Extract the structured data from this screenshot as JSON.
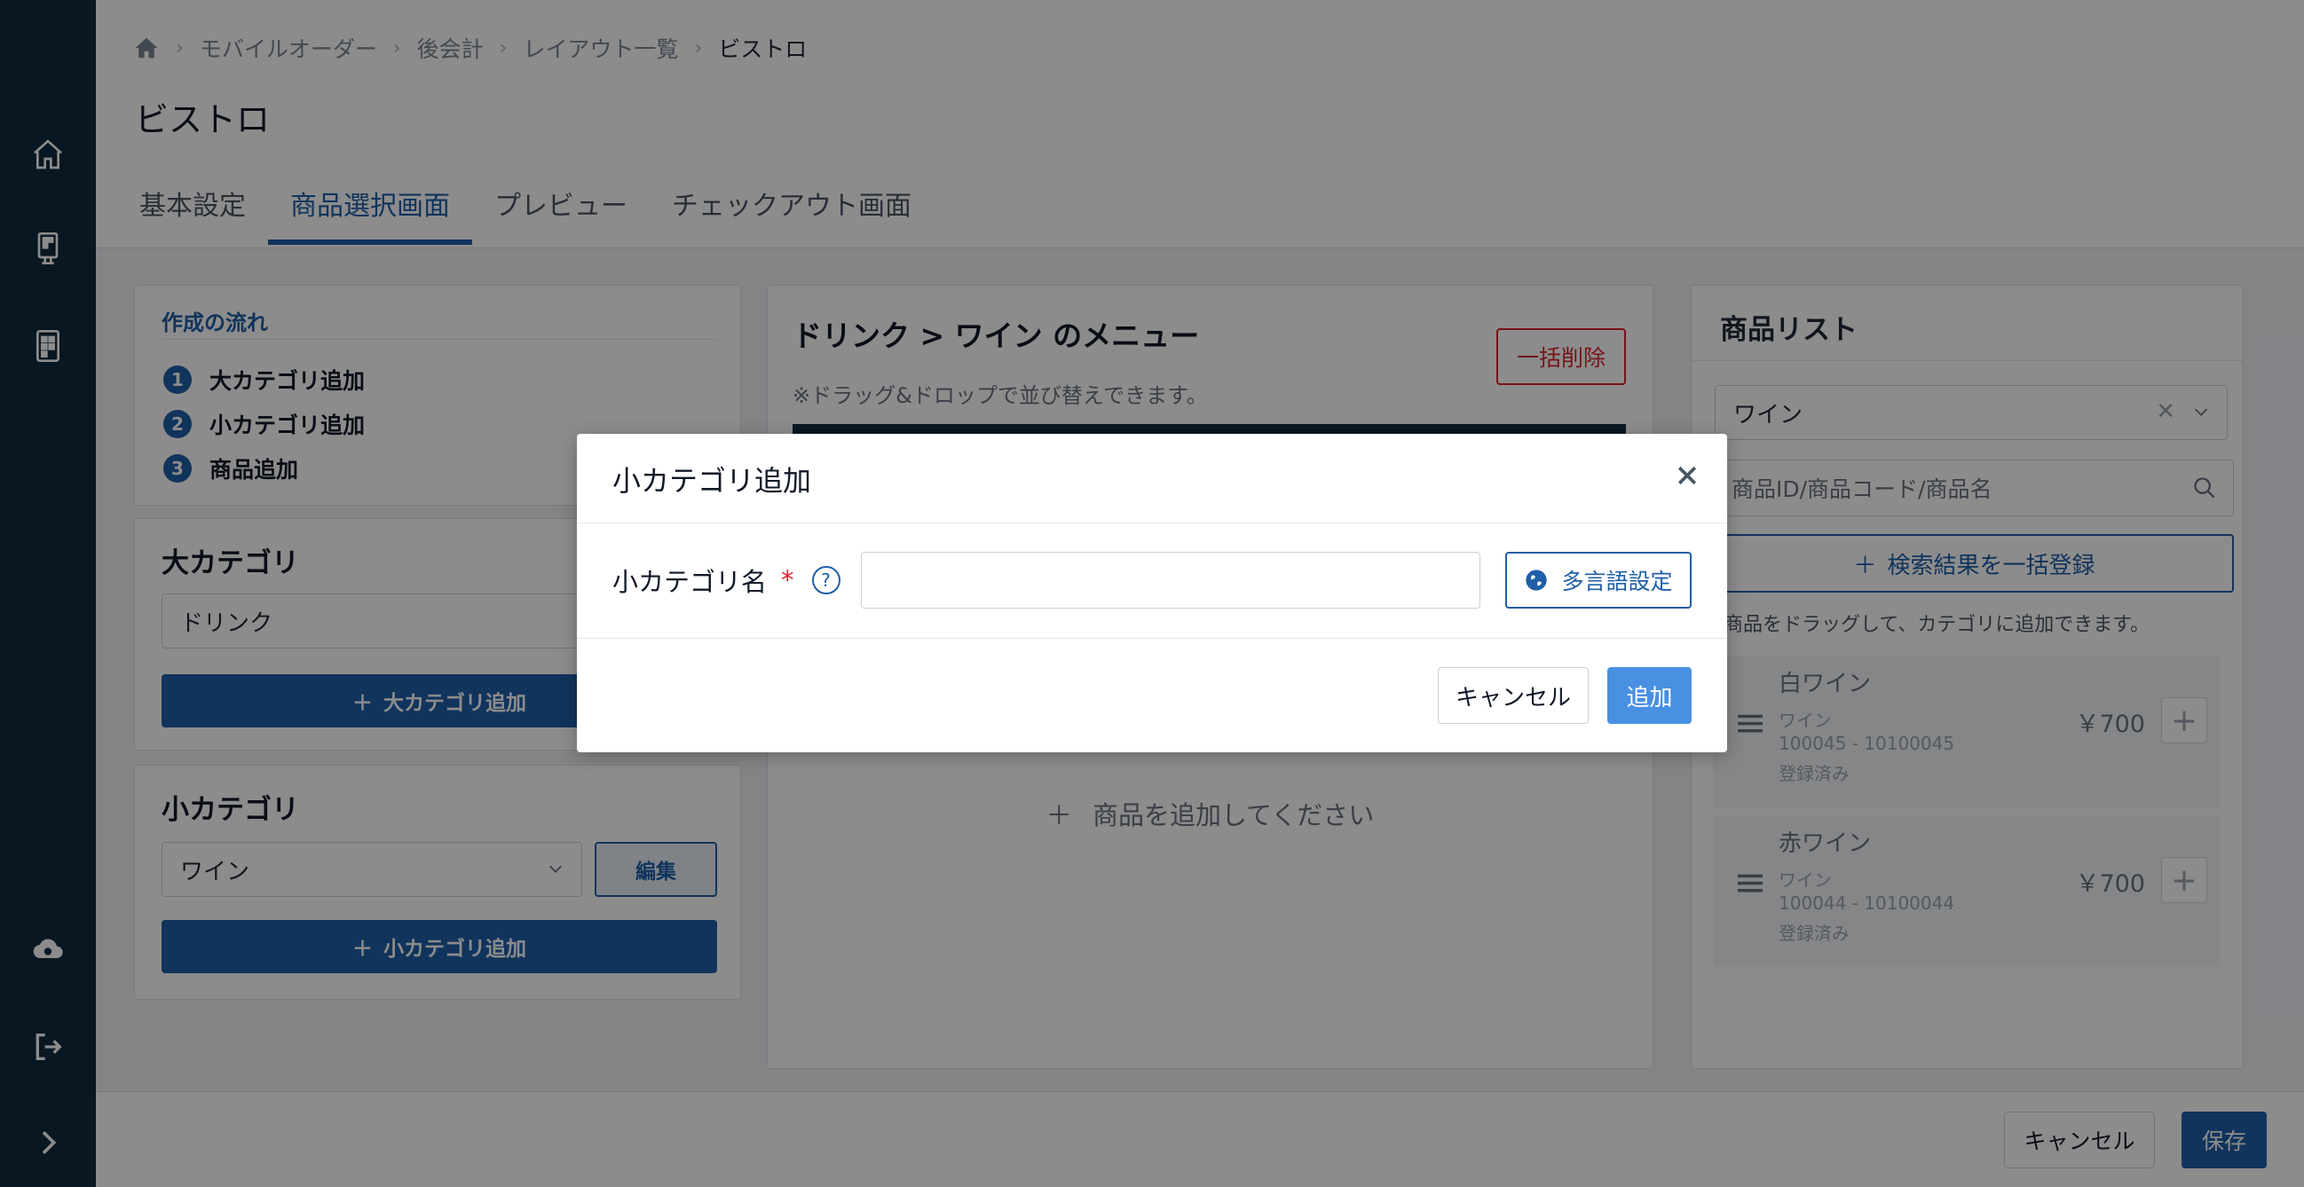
{
  "breadcrumb": {
    "items": [
      "モバイルオーダー",
      "後会計",
      "レイアウト一覧"
    ],
    "current": "ビストロ"
  },
  "page": {
    "title": "ビストロ"
  },
  "tabs": [
    {
      "label": "基本設定",
      "active": false
    },
    {
      "label": "商品選択画面",
      "active": true
    },
    {
      "label": "プレビュー",
      "active": false
    },
    {
      "label": "チェックアウト画面",
      "active": false
    }
  ],
  "flow": {
    "title": "作成の流れ",
    "steps": [
      {
        "num": "1",
        "label": "大カテゴリ追加"
      },
      {
        "num": "2",
        "label": "小カテゴリ追加"
      },
      {
        "num": "3",
        "label": "商品追加"
      }
    ]
  },
  "large_category": {
    "heading": "大カテゴリ",
    "selected": "ドリンク",
    "add_label": "大カテゴリ追加"
  },
  "small_category": {
    "heading": "小カテゴリ",
    "selected": "ワイン",
    "edit_label": "編集",
    "add_label": "小カテゴリ追加"
  },
  "menu": {
    "title": "ドリンク > ワイン のメニュー",
    "bulk_delete": "一括削除",
    "hint": "※ドラッグ&ドロップで並び替えできます。",
    "add_product": "商品を追加してください"
  },
  "product_list": {
    "title": "商品リスト",
    "filter_value": "ワイン",
    "search_placeholder": "商品ID/商品コード/商品名",
    "bulk_register": "検索結果を一括登録",
    "drag_hint": "商品をドラッグして、カテゴリに追加できます。",
    "items": [
      {
        "name": "白ワイン",
        "category": "ワイン",
        "code": "100045 - 10100045",
        "status": "登録済み",
        "price": "￥700"
      },
      {
        "name": "赤ワイン",
        "category": "ワイン",
        "code": "100044 - 10100044",
        "status": "登録済み",
        "price": "￥700"
      }
    ]
  },
  "footer": {
    "cancel": "キャンセル",
    "save": "保存"
  },
  "modal": {
    "title": "小カテゴリ追加",
    "field_label": "小カテゴリ名",
    "required_mark": "*",
    "help": "?",
    "input_value": "",
    "multilang": "多言語設定",
    "cancel": "キャンセル",
    "add": "追加"
  },
  "colors": {
    "sidebar": "#0f2a3d",
    "primary": "#1f5fa8",
    "danger": "#d7262e",
    "modal_add": "#4a90e2"
  },
  "icons": [
    "home-icon",
    "tablet-icon",
    "device-icon",
    "cloud-sync-icon",
    "logout-icon",
    "chevron-right-icon",
    "search-icon",
    "close-icon",
    "globe-icon",
    "drag-handle-icon"
  ]
}
